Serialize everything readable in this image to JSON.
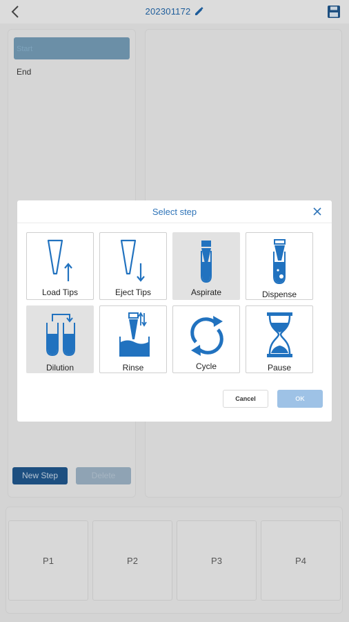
{
  "header": {
    "title": "202301172",
    "back_icon": "chevron-left-icon",
    "edit_icon": "pencil-icon",
    "save_icon": "floppy-disk-icon"
  },
  "steps": {
    "items": [
      "Start",
      "End"
    ]
  },
  "actions": {
    "new_step": "New Step",
    "delete": "Delete"
  },
  "positions": [
    "P1",
    "P2",
    "P3",
    "P4"
  ],
  "dialog": {
    "title": "Select step",
    "close_icon": "close-icon",
    "options": [
      {
        "label": "Load Tips",
        "icon": "load-tips-icon",
        "selected": false
      },
      {
        "label": "Eject Tips",
        "icon": "eject-tips-icon",
        "selected": false
      },
      {
        "label": "Aspirate",
        "icon": "aspirate-icon",
        "selected": true
      },
      {
        "label": "Dispense",
        "icon": "dispense-icon",
        "selected": false
      },
      {
        "label": "Dilution",
        "icon": "dilution-icon",
        "selected": true
      },
      {
        "label": "Rinse",
        "icon": "rinse-icon",
        "selected": false
      },
      {
        "label": "Cycle",
        "icon": "cycle-icon",
        "selected": false
      },
      {
        "label": "Pause",
        "icon": "hourglass-icon",
        "selected": false
      }
    ],
    "cancel": "Cancel",
    "ok": "OK"
  },
  "colors": {
    "accent": "#2172bf",
    "dialog_title": "#2f74b8",
    "ok_disabled": "#9ec2e6"
  }
}
